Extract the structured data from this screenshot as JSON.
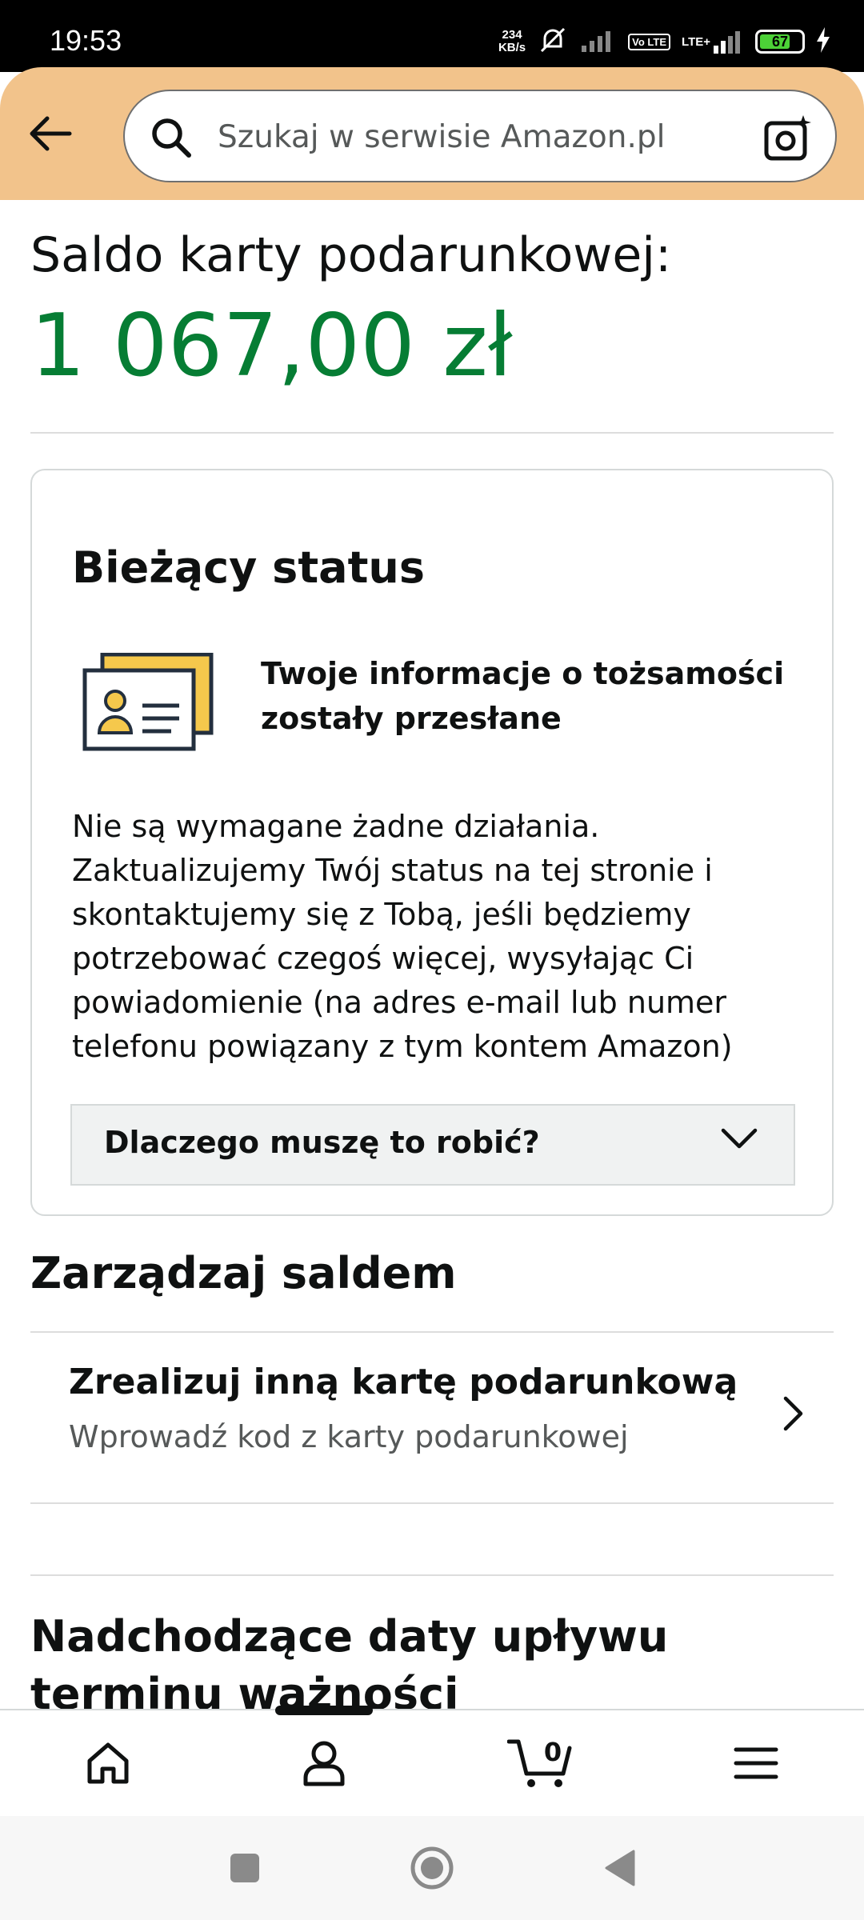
{
  "status_bar": {
    "time": "19:53",
    "net_speed_value": "234",
    "net_speed_unit": "KB/s",
    "lte_label": "LTE+",
    "volte_label": "Vo LTE",
    "battery_level": "67"
  },
  "header": {
    "search_placeholder": "Szukaj w serwisie Amazon.pl"
  },
  "balance": {
    "label": "Saldo karty podarunkowej:",
    "amount": "1 067,00 zł"
  },
  "status_card": {
    "title": "Bieżący status",
    "id_message": "Twoje informacje o tożsamości zostały przesłane",
    "description": "Nie są wymagane żadne działania. Zaktualizujemy Twój status na tej stronie i skontaktujemy się z Tobą, jeśli będziemy potrzebować czegoś więcej, wysyłając Ci powiadomienie (na adres e-mail lub numer telefonu powiązany z tym kontem Amazon)",
    "why_label": "Dlaczego muszę to robić?"
  },
  "manage": {
    "title": "Zarządzaj saldem",
    "redeem_title": "Zrealizuj inną kartę podarunkową",
    "redeem_subtitle": "Wprowadź kod z karty podarunkowej"
  },
  "expiry": {
    "title": "Nadchodzące daty upływu terminu ważności"
  },
  "bottom_nav": {
    "cart_count": "0",
    "active_tab": "account"
  },
  "colors": {
    "header_bg": "#f2c38b",
    "balance_green": "#067d34",
    "id_card_yellow": "#f5c84c",
    "id_card_navy": "#232f3e"
  }
}
